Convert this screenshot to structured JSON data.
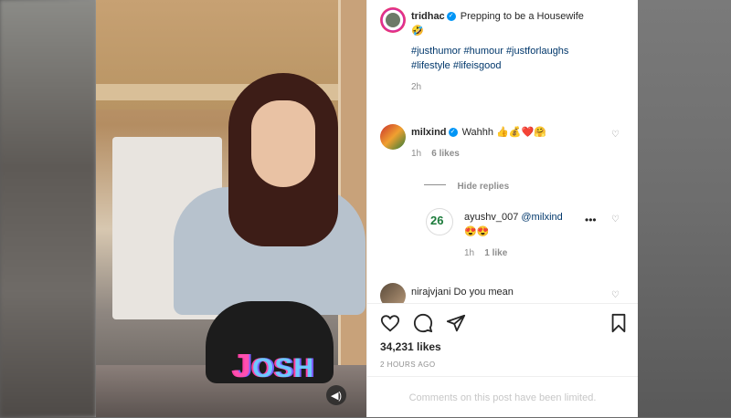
{
  "post": {
    "author": "tridhac",
    "caption": "Prepping to be a Housewife",
    "caption_emoji": "🤣",
    "hashtags_line1": "#justhumor #humour #justforlaughs",
    "hashtags_line2": "#lifestyle #lifeisgood",
    "caption_time": "2h"
  },
  "comments": [
    {
      "username": "milxind",
      "text": "Wahhh",
      "emojis": "👍💰❤️🤗",
      "time": "1h",
      "likes": "6 likes"
    }
  ],
  "hide_replies_label": "Hide replies",
  "reply": {
    "username": "ayushv_007",
    "mention": "@milxind",
    "emojis": "😍😍",
    "time": "1h",
    "likes": "1 like"
  },
  "partial_comment": {
    "username": "nirajvjani",
    "text": "Do you mean"
  },
  "actions": {
    "likes_count": "34,231 likes",
    "timestamp": "2 HOURS AGO"
  },
  "comments_limited": "Comments on this post have been limited.",
  "video_overlay": {
    "logo_text": "OSH",
    "logo_letter": "J",
    "mute_icon": "speaker-icon"
  },
  "colors": {
    "link": "#00376b",
    "verified": "#0095f6",
    "muted_text": "#8e8e8e"
  }
}
